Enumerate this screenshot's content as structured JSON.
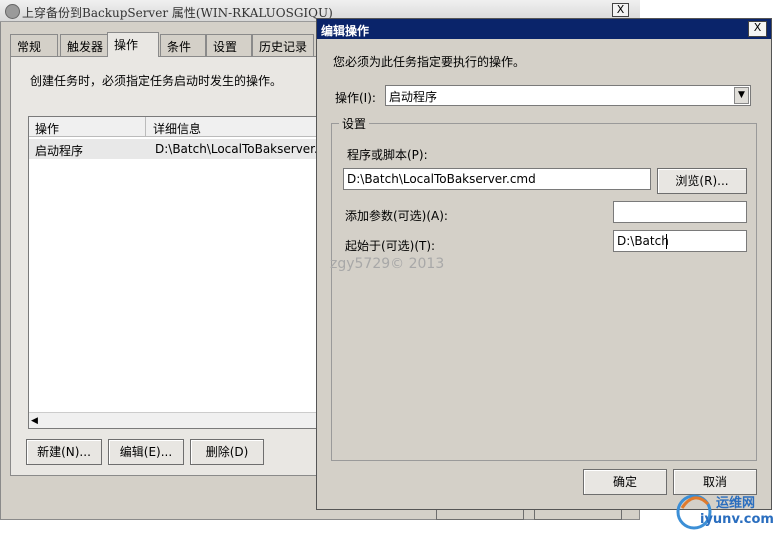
{
  "bg_window": {
    "title": "上穿备份到BackupServer 属性(WIN-RKALUOSGIQU)",
    "close": "X",
    "tabs": [
      "常规",
      "触发器",
      "操作",
      "条件",
      "设置",
      "历史记录"
    ],
    "description": "创建任务时，必须指定任务启动时发生的操作。",
    "list": {
      "columns": [
        "操作",
        "详细信息"
      ],
      "rows": [
        {
          "action": "启动程序",
          "detail": "D:\\Batch\\LocalToBakserver.cmd"
        }
      ]
    },
    "buttons": {
      "new": "新建(N)...",
      "edit": "编辑(E)...",
      "delete": "删除(D)"
    }
  },
  "dialog": {
    "title": "编辑操作",
    "close": "X",
    "hint": "您必须为此任务指定要执行的操作。",
    "action_label": "操作(I):",
    "action_value": "启动程序",
    "group_label": "设置",
    "program_label": "程序或脚本(P):",
    "program_value": "D:\\Batch\\LocalToBakserver.cmd",
    "browse_label": "浏览(R)...",
    "args_label": "添加参数(可选)(A):",
    "args_value": "",
    "startin_label": "起始于(可选)(T):",
    "startin_value": "D:\\Batch",
    "ok_label": "确定",
    "cancel_label": "取消"
  },
  "watermark": "zgy5729© 2013",
  "logo": {
    "name": "运维网",
    "url": "iyunv.com"
  },
  "colors": {
    "dialog_title": "#0a246a",
    "face": "#d4d0c8"
  }
}
